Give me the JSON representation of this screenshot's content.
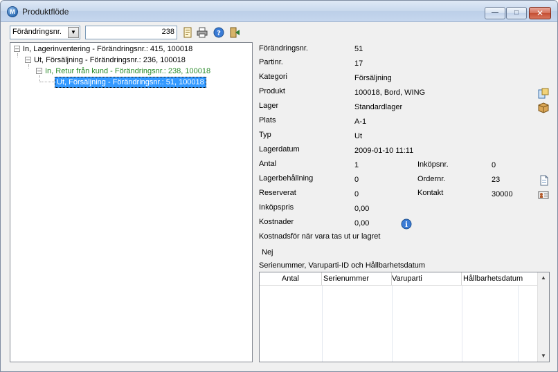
{
  "window": {
    "title": "Produktflöde",
    "icon": "app-logo-icon"
  },
  "toolbar": {
    "select_value": "Förändringsnr.",
    "number_value": "238",
    "icons": [
      "document-icon",
      "print-icon",
      "help-icon",
      "exit-icon"
    ]
  },
  "tree": {
    "nodes": [
      {
        "label": "In, Lagerinventering - Förändringsnr.: 415, 100018"
      },
      {
        "label": "Ut, Försäljning - Förändringsnr.: 236, 100018"
      },
      {
        "label": "In, Retur från kund - Förändringsnr.: 238, 100018"
      },
      {
        "label": "Ut, Försäljning - Förändringsnr.: 51, 100018"
      }
    ]
  },
  "details": {
    "forandringsnr": {
      "label": "Förändringsnr.",
      "value": "51"
    },
    "partinr": {
      "label": "Partinr.",
      "value": "17"
    },
    "kategori": {
      "label": "Kategori",
      "value": "Försäljning"
    },
    "produkt": {
      "label": "Produkt",
      "value": "100018, Bord, WING"
    },
    "lager": {
      "label": "Lager",
      "value": "Standardlager"
    },
    "plats": {
      "label": "Plats",
      "value": "A-1"
    },
    "typ": {
      "label": "Typ",
      "value": "Ut"
    },
    "lagerdatum": {
      "label": "Lagerdatum",
      "value": "2009-01-10 11:11"
    },
    "antal": {
      "label": "Antal",
      "value": "1"
    },
    "lagerbehallning": {
      "label": "Lagerbehållning",
      "value": "0"
    },
    "reserverat": {
      "label": "Reserverat",
      "value": "0"
    },
    "inkopspris": {
      "label": "Inköpspris",
      "value": "0,00"
    },
    "kostnader": {
      "label": "Kostnader",
      "value": "0,00"
    },
    "inkopsnr": {
      "label": "Inköpsnr.",
      "value": "0"
    },
    "ordernr": {
      "label": "Ordernr.",
      "value": "23"
    },
    "kontakt": {
      "label": "Kontakt",
      "value": "30000"
    },
    "kostnadsfor_label": "Kostnadsför när vara tas ut ur lagret",
    "kostnadsfor_value": "Nej",
    "serie_label": "Serienummer, Varuparti-ID och Hållbarhetsdatum"
  },
  "grid": {
    "columns": [
      "Antal",
      "Serienummer",
      "Varuparti",
      "Hållbarhetsdatum"
    ]
  }
}
